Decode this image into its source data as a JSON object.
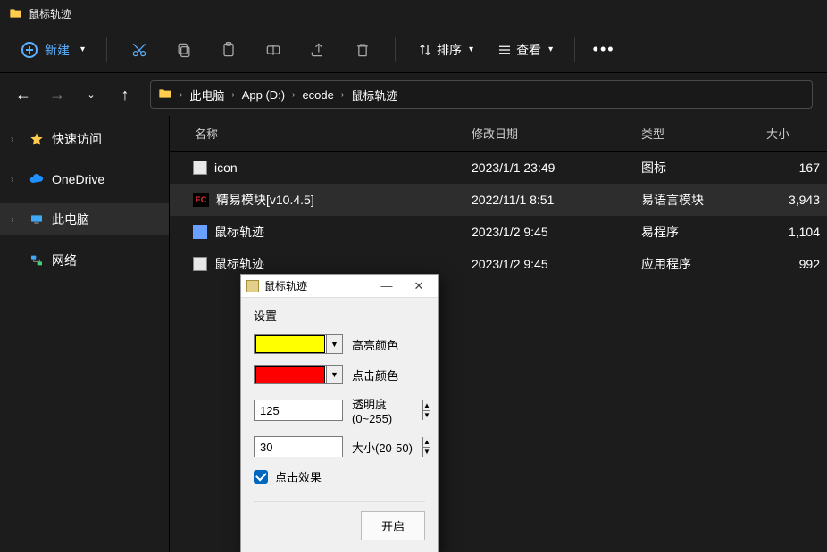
{
  "title": "鼠标轨迹",
  "toolbar": {
    "new_label": "新建",
    "sort_label": "排序",
    "view_label": "查看"
  },
  "breadcrumb": [
    "此电脑",
    "App (D:)",
    "ecode",
    "鼠标轨迹"
  ],
  "sidebar": {
    "items": [
      {
        "label": "快速访问"
      },
      {
        "label": "OneDrive"
      },
      {
        "label": "此电脑"
      },
      {
        "label": "网络"
      }
    ]
  },
  "columns": {
    "name": "名称",
    "date": "修改日期",
    "type": "类型",
    "size": "大小"
  },
  "rows": [
    {
      "name": "icon",
      "date": "2023/1/1 23:49",
      "type": "图标",
      "size": "167"
    },
    {
      "name": "精易模块[v10.4.5]",
      "date": "2022/11/1 8:51",
      "type": "易语言模块",
      "size": "3,943"
    },
    {
      "name": "鼠标轨迹",
      "date": "2023/1/2 9:45",
      "type": "易程序",
      "size": "1,104"
    },
    {
      "name": "鼠标轨迹",
      "date": "2023/1/2 9:45",
      "type": "应用程序",
      "size": "992"
    }
  ],
  "dialog": {
    "title": "鼠标轨迹",
    "section": "设置",
    "rows": {
      "highlight_label": "高亮颜色",
      "click_label": "点击颜色",
      "alpha_label": "透明度(0~255)",
      "size_label": "大小(20-50)",
      "effect_label": "点击效果"
    },
    "values": {
      "alpha": "125",
      "size": "30"
    },
    "colors": {
      "highlight": "#ffff00",
      "click": "#ff0000"
    },
    "button": "开启"
  }
}
